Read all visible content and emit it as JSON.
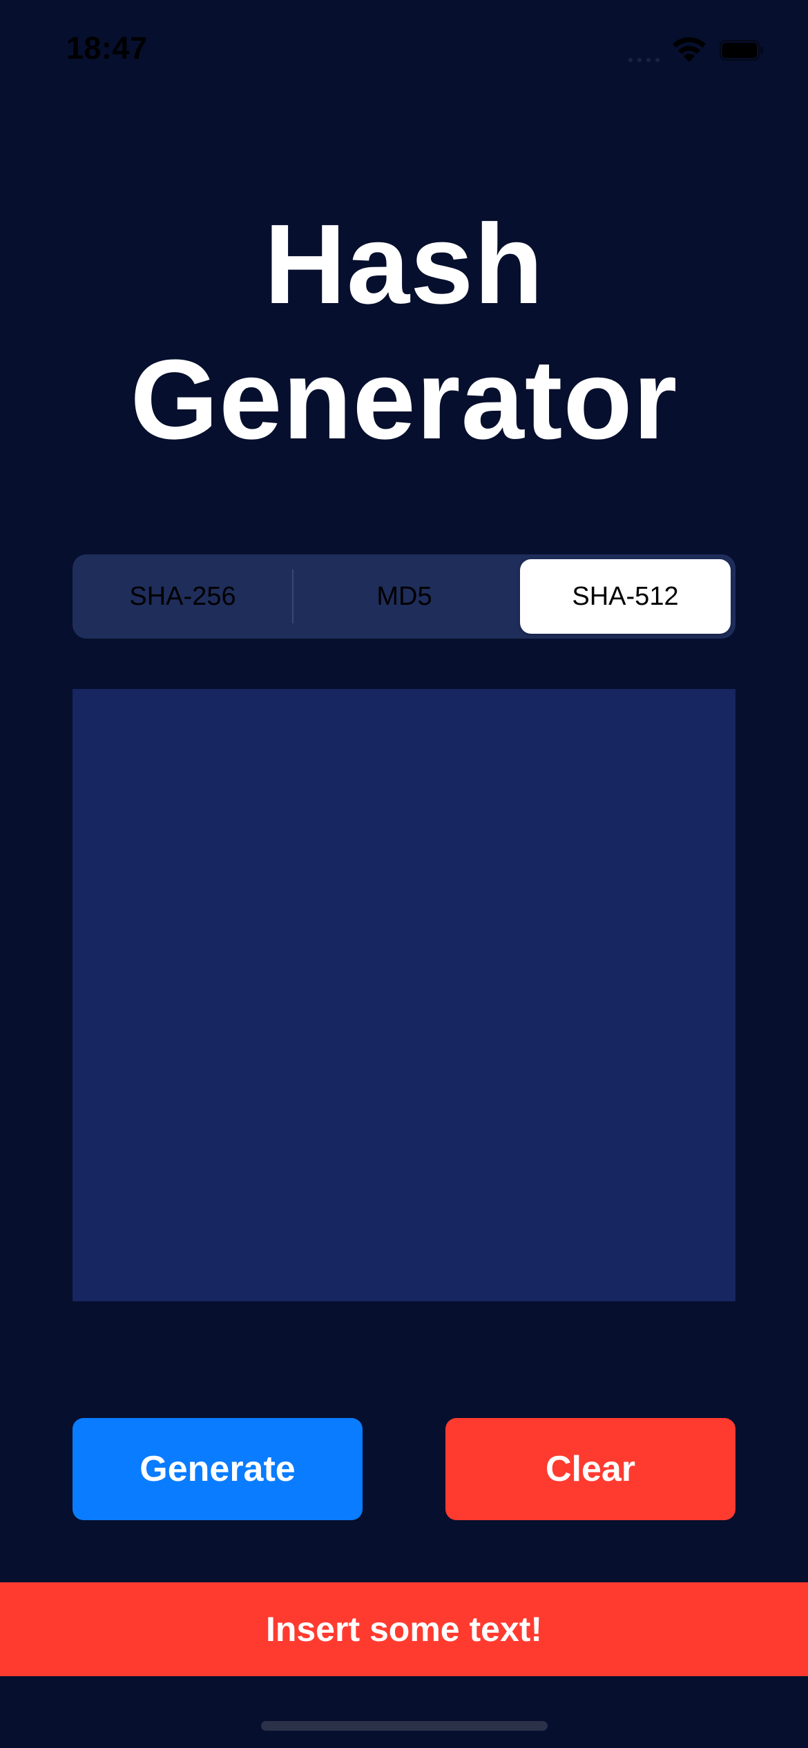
{
  "status_bar": {
    "time": "18:47",
    "icons": [
      "cellular-signal-icon",
      "wifi-icon",
      "battery-icon"
    ]
  },
  "title": {
    "line1": "Hash",
    "line2": "Generator"
  },
  "algorithm_picker": {
    "options": [
      "SHA-256",
      "MD5",
      "SHA-512"
    ],
    "selected": "SHA-512"
  },
  "input": {
    "value": "",
    "placeholder": ""
  },
  "actions": {
    "generate_label": "Generate",
    "clear_label": "Clear"
  },
  "toast": {
    "message": "Insert some text!"
  },
  "colors": {
    "background": "#060f2d",
    "input_background": "#172660",
    "segmented_background": "#1f2d5a",
    "generate_button": "#0a7cff",
    "clear_button": "#ff3b30",
    "toast_background": "#ff3b30"
  }
}
